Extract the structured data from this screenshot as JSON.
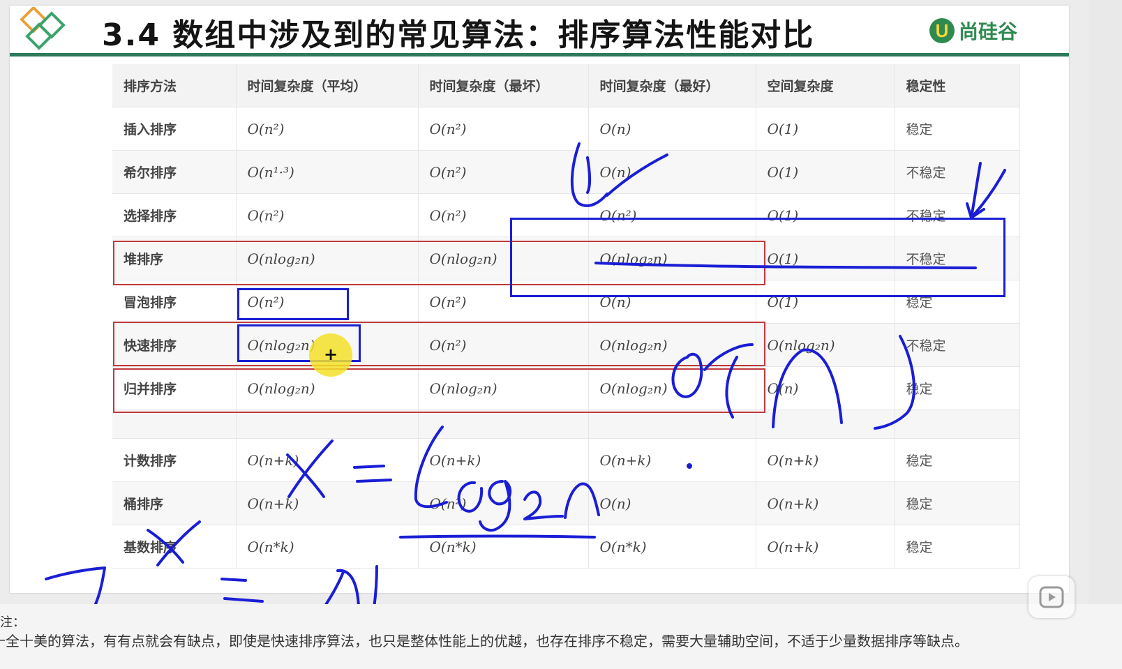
{
  "title": "3.4 数组中涉及到的常见算法：排序算法性能对比",
  "brand": {
    "mark": "U",
    "name": "尚硅谷"
  },
  "table": {
    "headers": [
      "排序方法",
      "时间复杂度（平均）",
      "时间复杂度（最坏）",
      "时间复杂度（最好）",
      "空间复杂度",
      "稳定性"
    ],
    "rows": [
      [
        "插入排序",
        "O(n²)",
        "O(n²)",
        "O(n)",
        "O(1)",
        "稳定"
      ],
      [
        "希尔排序",
        "O(n¹·³)",
        "O(n²)",
        "O(n)",
        "O(1)",
        "不稳定"
      ],
      [
        "选择排序",
        "O(n²)",
        "O(n²)",
        "O(n²)",
        "O(1)",
        "不稳定"
      ],
      [
        "堆排序",
        "O(nlog₂n)",
        "O(nlog₂n)",
        "O(nlog₂n)",
        "O(1)",
        "不稳定"
      ],
      [
        "冒泡排序",
        "O(n²)",
        "O(n²)",
        "O(n)",
        "O(1)",
        "稳定"
      ],
      [
        "快速排序",
        "O(nlog₂n)",
        "O(n²)",
        "O(nlog₂n)",
        "O(nlog₂n)",
        "不稳定"
      ],
      [
        "归并排序",
        "O(nlog₂n)",
        "O(nlog₂n)",
        "O(nlog₂n)",
        "O(n)",
        "稳定"
      ]
    ],
    "rows2": [
      [
        "计数排序",
        "O(n+k)",
        "O(n+k)",
        "O(n+k)",
        "O(n+k)",
        "稳定"
      ],
      [
        "桶排序",
        "O(n+k)",
        "O(n²)",
        "O(n)",
        "O(n+k)",
        "稳定"
      ],
      [
        "基数排序",
        "O(n*k)",
        "O(n*k)",
        "O(n*k)",
        "O(n+k)",
        "稳定"
      ]
    ]
  },
  "caption": {
    "line1": "注：",
    "line2": "十全十美的算法，有有点就会有缺点，即使是快速排序算法，也只是整体性能上的优越，也存在排序不稳定，需要大量辅助空间，不适于少量数据排序等缺点。"
  },
  "colors": {
    "header_line": "#2d7a5a",
    "red_box": "#c0393b",
    "blue_ink": "#1a1ed4",
    "brand": "#2f8a4f"
  }
}
